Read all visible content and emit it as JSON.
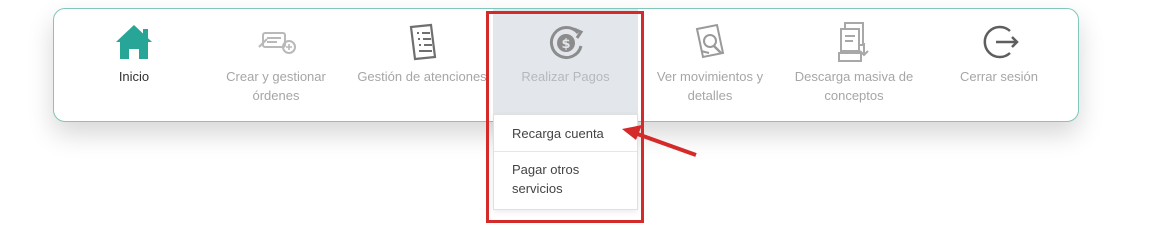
{
  "nav": {
    "items": [
      {
        "label": "Inicio",
        "icon": "home-icon"
      },
      {
        "label": "Crear y gestionar órdenes",
        "icon": "create-order-icon"
      },
      {
        "label": "Gestión de atenciones",
        "icon": "document-list-icon"
      },
      {
        "label": "Realizar Pagos",
        "icon": "payment-dollar-icon"
      },
      {
        "label": "Ver movimientos y detalles",
        "icon": "search-document-icon"
      },
      {
        "label": "Descarga masiva de conceptos",
        "icon": "bulk-download-icon"
      },
      {
        "label": "Cerrar sesión",
        "icon": "logout-icon"
      }
    ]
  },
  "dropdown": {
    "items": [
      {
        "label": "Recarga cuenta"
      },
      {
        "label": "Pagar otros servicios"
      }
    ]
  },
  "colors": {
    "accent_teal": "#27a596",
    "highlight_red": "#d42a2a",
    "border_teal": "#7fc7bb"
  }
}
